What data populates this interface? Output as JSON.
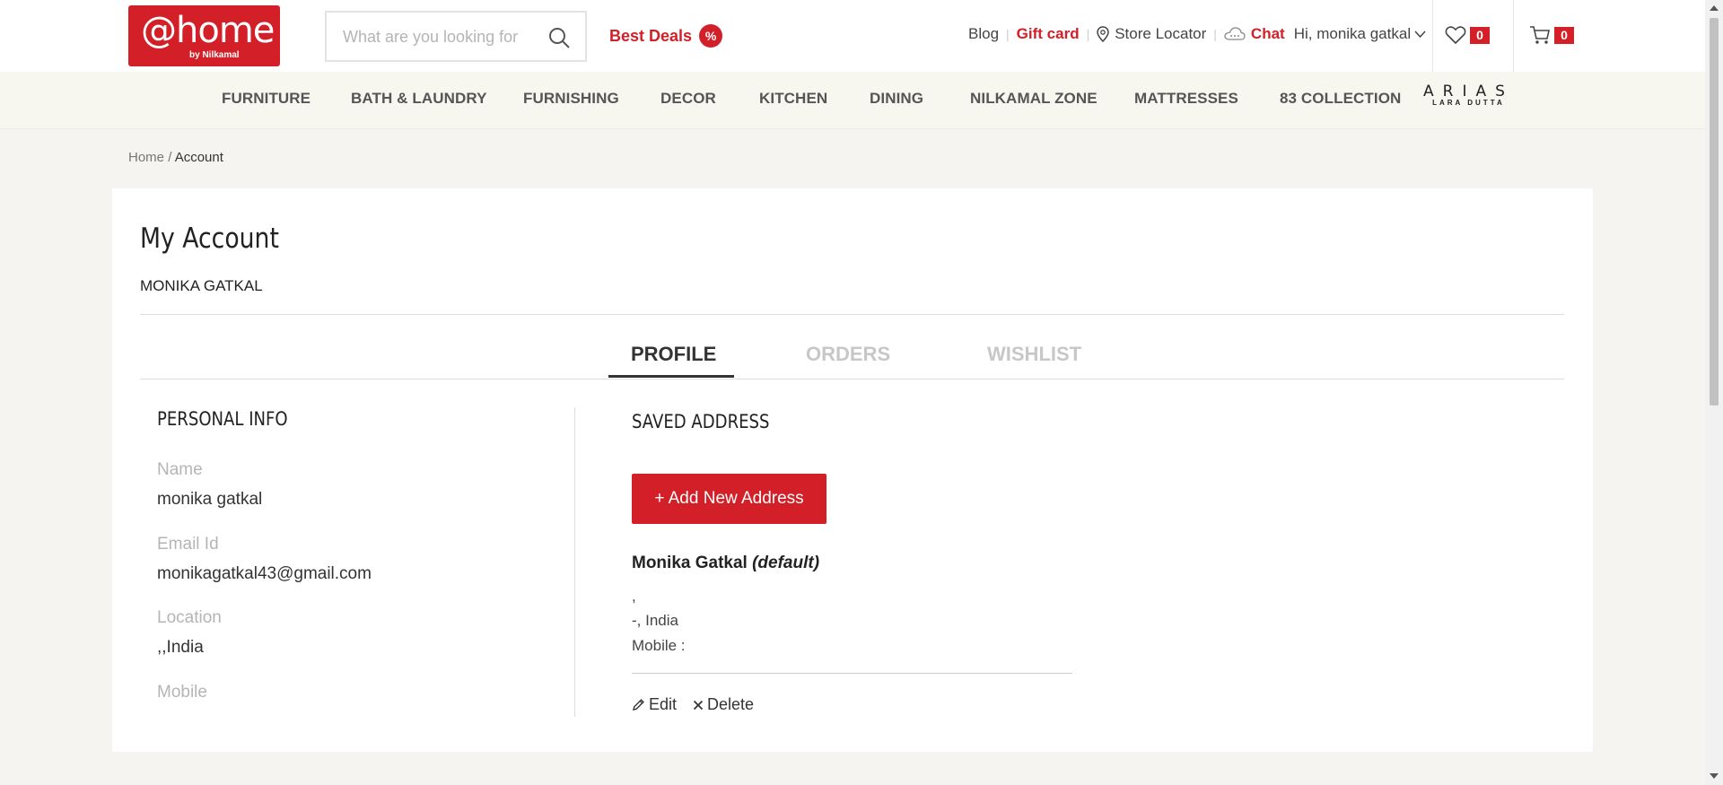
{
  "brand": {
    "logo_text": "@home",
    "logo_sub": "by Nilkamal",
    "color": "#d31f28"
  },
  "header": {
    "search_placeholder": "What are you looking for",
    "best_deals": "Best Deals",
    "best_deals_badge": "%",
    "links": {
      "blog": "Blog",
      "gift_card": "Gift card",
      "store_locator": "Store Locator",
      "chat": "Chat",
      "greeting": "Hi, monika gatkal"
    },
    "wishlist_count": "0",
    "cart_count": "0",
    "icons": [
      "search-icon",
      "location-pin-icon",
      "chat-cloud-icon",
      "chevron-down-icon",
      "heart-icon",
      "cart-icon"
    ]
  },
  "nav": {
    "items": [
      "FURNITURE",
      "BATH & LAUNDRY",
      "FURNISHING",
      "DECOR",
      "KITCHEN",
      "DINING",
      "NILKAMAL ZONE",
      "MATTRESSES",
      "83 COLLECTION"
    ],
    "arias_logo": "ARIAS",
    "arias_sub": "LARA DUTTA"
  },
  "breadcrumb": {
    "home": "Home",
    "separator": "/",
    "current": "Account"
  },
  "account": {
    "title": "My Account",
    "user_name": "MONIKA GATKAL",
    "tabs": [
      "PROFILE",
      "ORDERS",
      "WISHLIST"
    ],
    "active_tab": "PROFILE"
  },
  "personal_info": {
    "title": "PERSONAL INFO",
    "name_label": "Name",
    "name_value": "monika gatkal",
    "email_label": "Email Id",
    "email_value": "monikagatkal43@gmail.com",
    "location_label": "Location",
    "location_value": ",,India",
    "mobile_label": "Mobile"
  },
  "saved_address": {
    "title": "SAVED ADDRESS",
    "add_button": "+ Add New Address",
    "address_name": "Monika Gatkal",
    "default_tag": "(default)",
    "line1": ",",
    "line2": "-, India",
    "mobile_line": "Mobile :",
    "edit": "Edit",
    "delete": "Delete"
  }
}
